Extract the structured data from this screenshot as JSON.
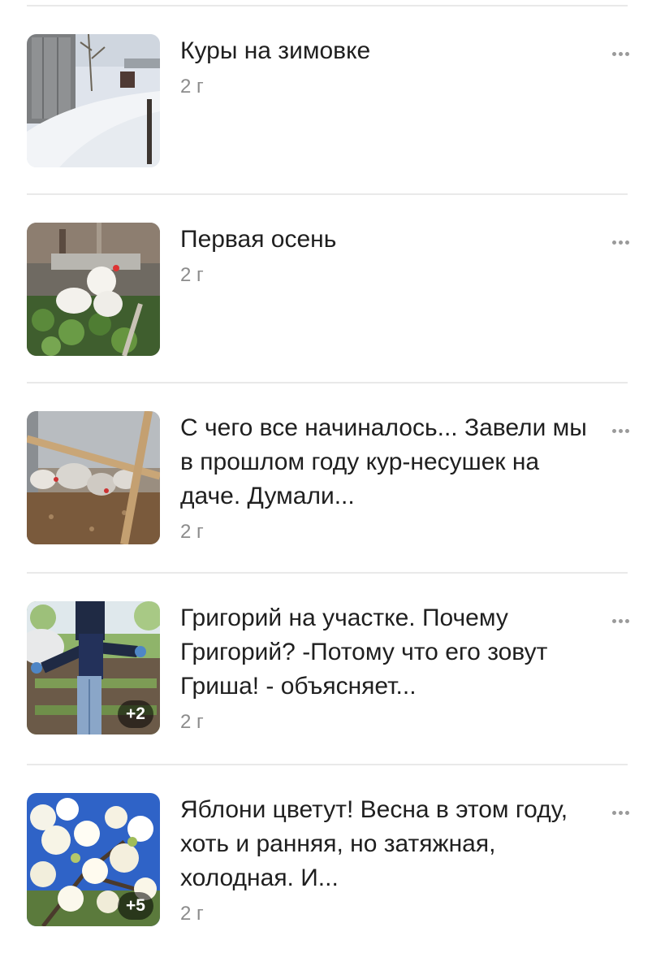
{
  "posts": [
    {
      "title": "Куры на зимовке",
      "age": "2 г",
      "thumb_icon": "snowy-yard-photo",
      "extra": ""
    },
    {
      "title": "Первая осень",
      "age": "2 г",
      "thumb_icon": "hens-in-garden-photo",
      "extra": ""
    },
    {
      "title": "С чего все начиналось... Завели мы в прошлом году кур-несушек на даче. Думали...",
      "age": "2 г",
      "thumb_icon": "hens-in-coop-photo",
      "extra": ""
    },
    {
      "title": "Григорий на участке. Почему Григорий? -Потому что его зовут Гриша! - объясняет...",
      "age": "2 г",
      "thumb_icon": "scarecrow-photo",
      "extra": "+2"
    },
    {
      "title": "Яблони цветут! Весна в этом году, хоть и ранняя, но затяжная, холодная. И...",
      "age": "2 г",
      "thumb_icon": "apple-blossom-photo",
      "extra": "+5"
    }
  ],
  "menu_icon": "more-dots-icon"
}
